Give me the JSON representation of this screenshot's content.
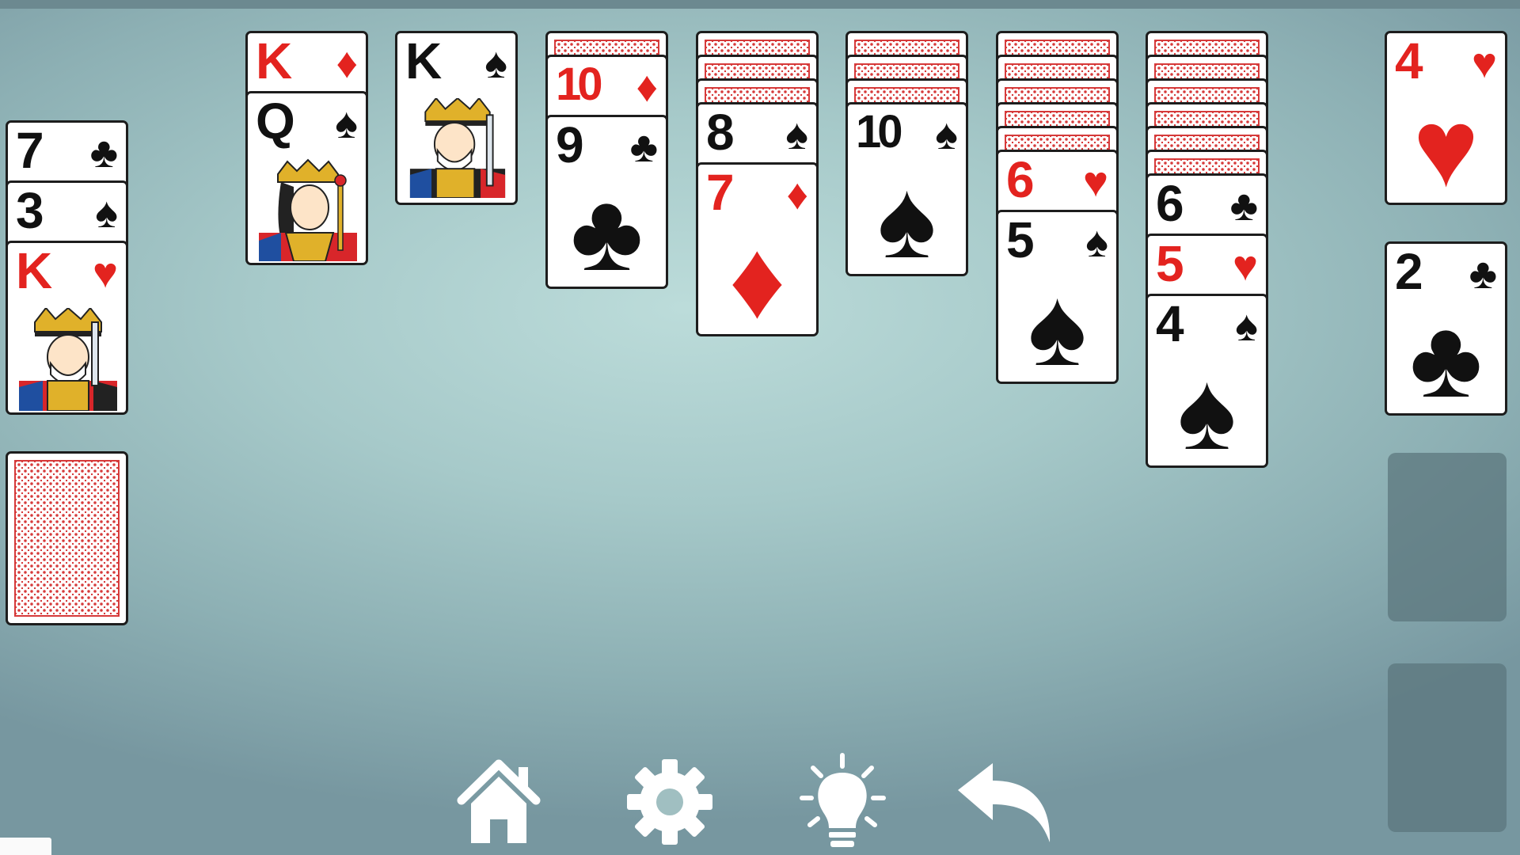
{
  "colors": {
    "red_suit": "#e3231f",
    "black_suit": "#111111",
    "card_back": "#d63a3a",
    "felt_center": "#bcdcda",
    "felt_edge": "#7797a0",
    "foundation_slot": "#5a757c",
    "toolbar_icon": "#ffffff"
  },
  "waste": {
    "cards": [
      {
        "rank": "7",
        "suit": "♣"
      },
      {
        "rank": "3",
        "suit": "♠"
      },
      {
        "rank": "K",
        "suit": "♥"
      }
    ]
  },
  "stock": {
    "face_down": true
  },
  "tableau": {
    "pile1": {
      "cards": [
        {
          "rank": "K",
          "suit": "♦"
        },
        {
          "rank": "Q",
          "suit": "♠"
        }
      ]
    },
    "pile2": {
      "cards": [
        {
          "rank": "K",
          "suit": "♠"
        }
      ]
    },
    "pile3": {
      "face_down_count": 1,
      "cards": [
        {
          "rank": "10",
          "suit": "♦"
        },
        {
          "rank": "9",
          "suit": "♣"
        }
      ]
    },
    "pile4": {
      "face_down_count": 3,
      "cards": [
        {
          "rank": "8",
          "suit": "♠"
        },
        {
          "rank": "7",
          "suit": "♦"
        }
      ]
    },
    "pile5": {
      "face_down_count": 3,
      "cards": [
        {
          "rank": "10",
          "suit": "♠"
        }
      ]
    },
    "pile6": {
      "face_down_count": 5,
      "cards": [
        {
          "rank": "6",
          "suit": "♥"
        },
        {
          "rank": "5",
          "suit": "♠"
        }
      ]
    },
    "pile7": {
      "face_down_count": 6,
      "cards": [
        {
          "rank": "6",
          "suit": "♣"
        },
        {
          "rank": "5",
          "suit": "♥"
        },
        {
          "rank": "4",
          "suit": "♠"
        }
      ]
    }
  },
  "foundations": [
    {
      "rank": "4",
      "suit": "♥"
    },
    {
      "rank": "2",
      "suit": "♣"
    },
    {
      "empty": true
    },
    {
      "empty": true
    }
  ],
  "toolbar": {
    "home_icon": "home-icon",
    "settings_icon": "gear-icon",
    "hint_icon": "lightbulb-icon",
    "undo_icon": "undo-arrow-icon"
  }
}
